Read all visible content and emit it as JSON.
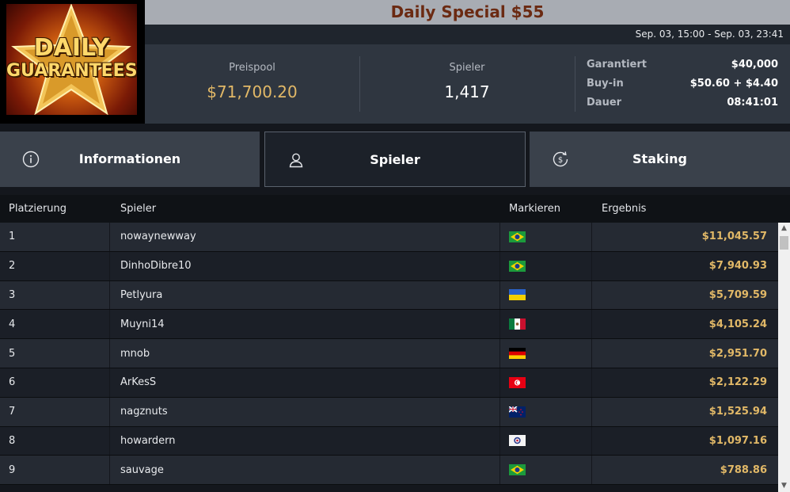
{
  "logo": {
    "line1": "DAILY",
    "line2": "GUARANTEES"
  },
  "tournament": {
    "title": "Daily Special $55",
    "date_range": "Sep. 03, 15:00 - Sep. 03, 23:41"
  },
  "stats": {
    "prize_pool_label": "Preispool",
    "prize_pool_value": "$71,700.20",
    "players_label": "Spieler",
    "players_value": "1,417",
    "guaranteed_label": "Garantiert",
    "guaranteed_value": "$40,000",
    "buyin_label": "Buy-in",
    "buyin_value": "$50.60 + $4.40",
    "duration_label": "Dauer",
    "duration_value": "08:41:01"
  },
  "tabs": [
    {
      "label": "Informationen",
      "icon": "info-icon"
    },
    {
      "label": "Spieler",
      "icon": "user-icon",
      "active": true
    },
    {
      "label": "Staking",
      "icon": "dollar-refresh-icon"
    }
  ],
  "table": {
    "headers": {
      "rank": "Platzierung",
      "player": "Spieler",
      "flag": "Markieren",
      "result": "Ergebnis"
    },
    "rows": [
      {
        "rank": "1",
        "player": "nowaynewway",
        "flag": "brazil",
        "result": "$11,045.57"
      },
      {
        "rank": "2",
        "player": "DinhoDibre10",
        "flag": "brazil",
        "result": "$7,940.93"
      },
      {
        "rank": "3",
        "player": "Petlyura",
        "flag": "ukraine",
        "result": "$5,709.59"
      },
      {
        "rank": "4",
        "player": "Muyni14",
        "flag": "mexico",
        "result": "$4,105.24"
      },
      {
        "rank": "5",
        "player": "mnob",
        "flag": "germany",
        "result": "$2,951.70"
      },
      {
        "rank": "6",
        "player": "ArKesS",
        "flag": "tunisia",
        "result": "$2,122.29"
      },
      {
        "rank": "7",
        "player": "nagznuts",
        "flag": "new-zealand",
        "result": "$1,525.94"
      },
      {
        "rank": "8",
        "player": "howardern",
        "flag": "other",
        "result": "$1,097.16"
      },
      {
        "rank": "9",
        "player": "sauvage",
        "flag": "brazil",
        "result": "$788.86"
      }
    ]
  },
  "colors": {
    "accent_gold": "#e1b867",
    "title_text": "#6b2a12"
  }
}
